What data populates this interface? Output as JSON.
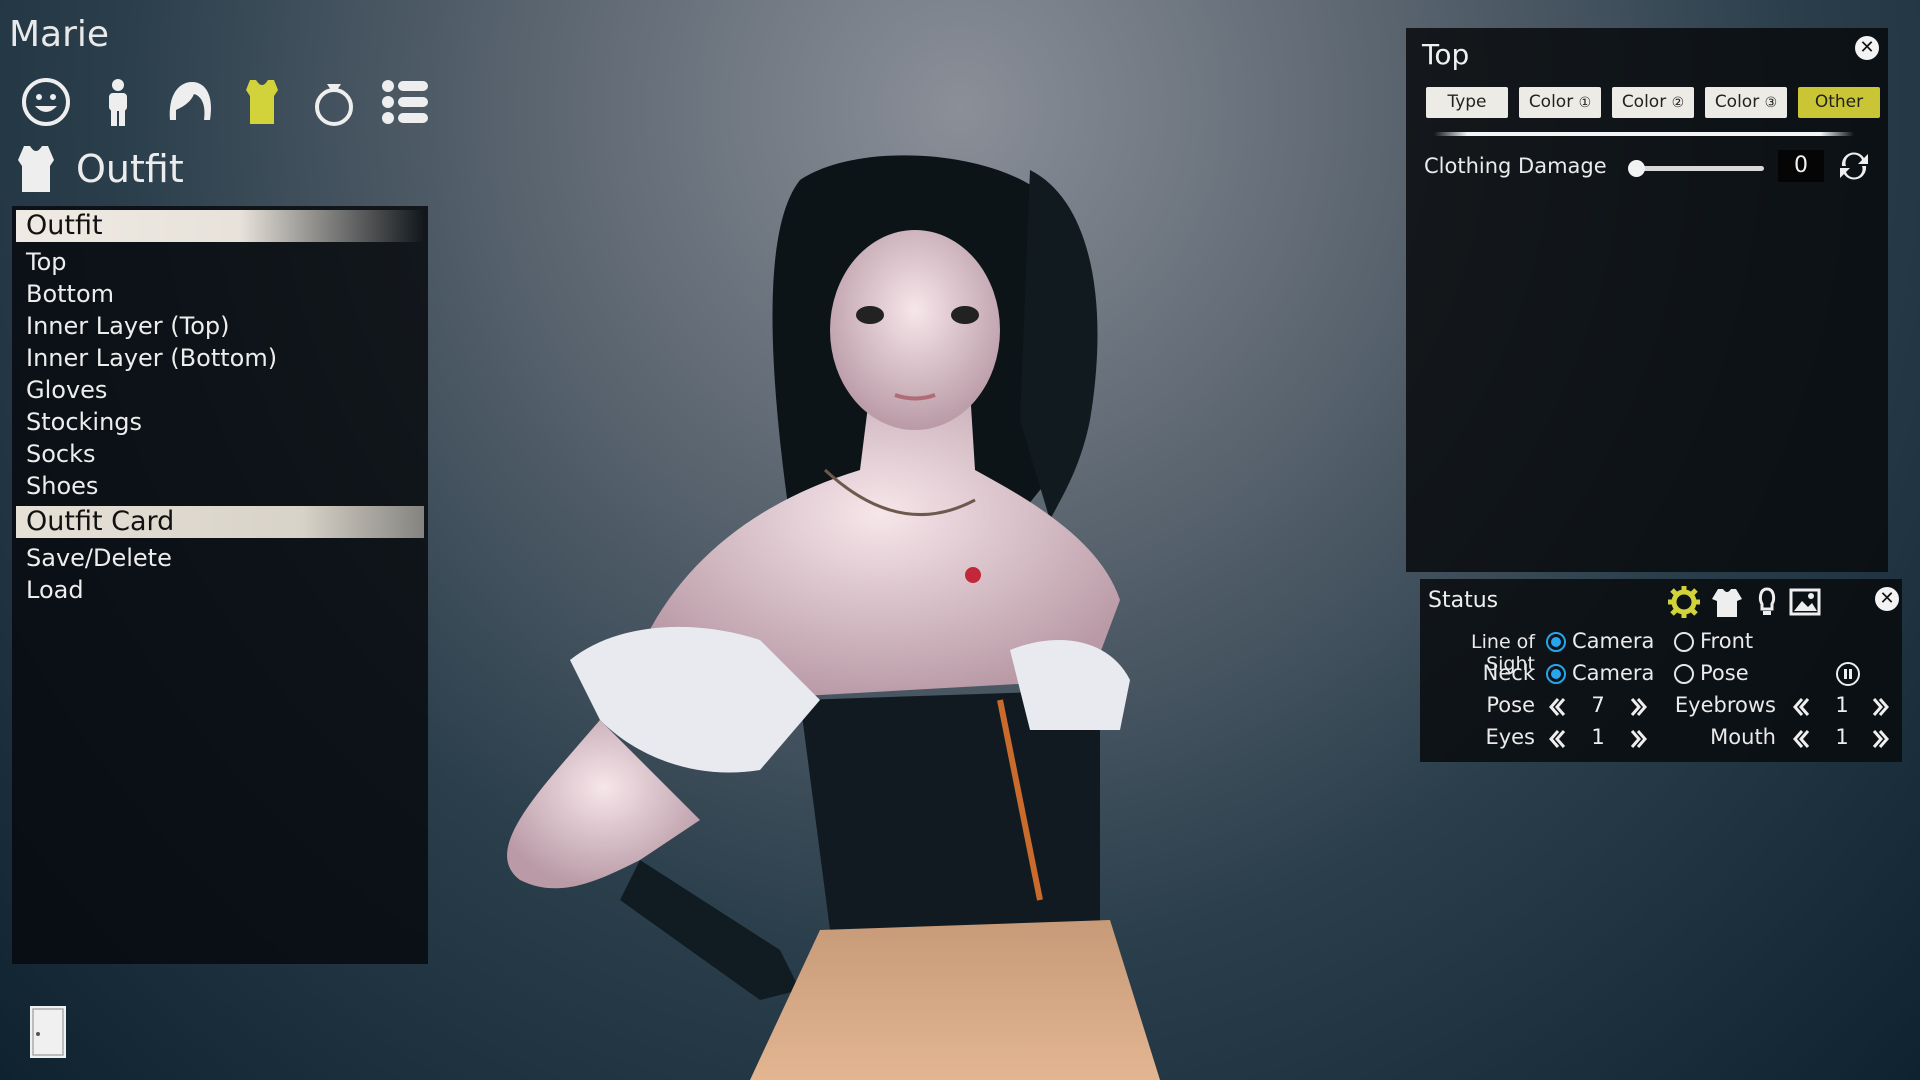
{
  "character": {
    "name": "Marie"
  },
  "category_tabs": [
    {
      "icon": "face-icon",
      "active": false
    },
    {
      "icon": "body-icon",
      "active": false
    },
    {
      "icon": "hair-icon",
      "active": false
    },
    {
      "icon": "clothing-icon",
      "active": true
    },
    {
      "icon": "accessory-ring-icon",
      "active": false
    },
    {
      "icon": "list-menu-icon",
      "active": false
    }
  ],
  "section": {
    "icon": "shirt-icon",
    "title": "Outfit"
  },
  "left_panel": {
    "group1": "Outfit",
    "items1": [
      "Top",
      "Bottom",
      "Inner Layer (Top)",
      "Inner Layer (Bottom)",
      "Gloves",
      "Stockings",
      "Socks",
      "Shoes"
    ],
    "group2": "Outfit Card",
    "items2": [
      "Save/Delete",
      "Load"
    ]
  },
  "top_panel": {
    "title": "Top",
    "tabs": [
      {
        "label": "Type",
        "num": "",
        "active": false
      },
      {
        "label": "Color",
        "num": "①",
        "active": false
      },
      {
        "label": "Color",
        "num": "②",
        "active": false
      },
      {
        "label": "Color",
        "num": "③",
        "active": false
      },
      {
        "label": "Other",
        "num": "",
        "active": true
      }
    ],
    "clothing_damage_label": "Clothing Damage",
    "clothing_damage_value": "0",
    "clothing_damage_fraction": 0.0
  },
  "status_panel": {
    "title": "Status",
    "icons": [
      "gear-icon",
      "outfit-icon",
      "light-bulb-icon",
      "background-image-icon"
    ],
    "line_of_sight_label": "Line of Sight",
    "line_of_sight_options": [
      "Camera",
      "Front"
    ],
    "line_of_sight_selected": "Camera",
    "neck_label": "Neck",
    "neck_options": [
      "Camera",
      "Pose"
    ],
    "neck_selected": "Camera",
    "pose_label": "Pose",
    "pose_value": "7",
    "eyebrows_label": "Eyebrows",
    "eyebrows_value": "1",
    "eyes_label": "Eyes",
    "eyes_value": "1",
    "mouth_label": "Mouth",
    "mouth_value": "1"
  },
  "colors": {
    "accent_yellow": "#c9c535",
    "radio_blue": "#27a6f0"
  }
}
